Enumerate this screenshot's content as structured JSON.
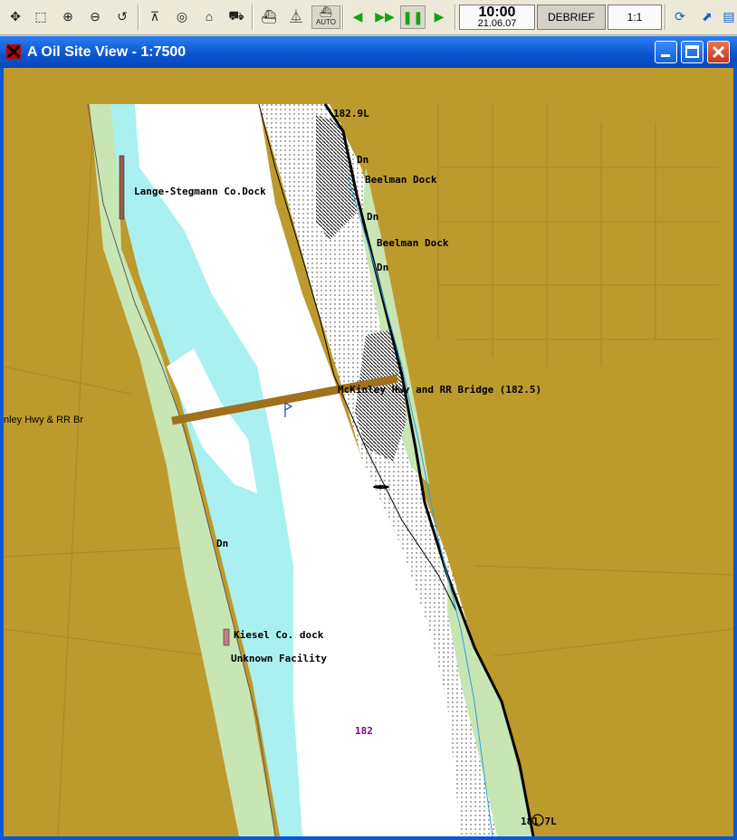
{
  "toolbar": {
    "tools": [
      "move-icon",
      "select-box-icon",
      "zoom-in-icon",
      "zoom-out-icon",
      "undo-icon",
      "compass-icon",
      "target-icon",
      "home-icon",
      "vessel-icon",
      "ship-icon",
      "boat-icon",
      "auto-ship-icon",
      "step-back-icon",
      "fast-forward-icon",
      "pause-icon",
      "play-icon"
    ],
    "auto_label": "AUTO",
    "clock_time": "10:00",
    "clock_date": "21.06.07",
    "debrief_label": "DEBRIEF",
    "scale_label": "1:1"
  },
  "window": {
    "title": "A Oil Site View - 1:7500"
  },
  "map": {
    "labels": {
      "mile_top": "182.9L",
      "dn1": "Dn",
      "beelman1": "Beelman Dock",
      "dn2": "Dn",
      "beelman2": "Beelman Dock",
      "dn3": "Dn",
      "lange": "Lange-Stegmann Co.Dock",
      "bridge": "McKinley Hwy and RR Bridge (182.5)",
      "bridge_left": "nley Hwy & RR Br",
      "dn4": "Dn",
      "kiesel": "Kiesel Co. dock",
      "unknown": "Unknown Facility",
      "mile_182": "182",
      "mile_bottom": "181.7L"
    },
    "colors": {
      "land": "#bd9a2c",
      "shallow_water": "#aaf0f0",
      "channel": "#ffffff",
      "bank_green": "#c8e6b4",
      "bridge": "#a0701c",
      "mile_marker": "#800080"
    }
  }
}
